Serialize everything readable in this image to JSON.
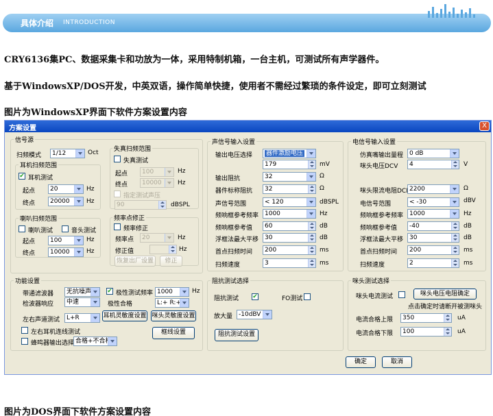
{
  "header": {
    "title": "具体介绍",
    "subtitle": "INTRODUCTION"
  },
  "paragraphs": [
    "CRY6136集PC、数据采集卡和功放为一体，采用特制机箱，一台主机，可测试所有声学器件。",
    "基于WindowsXP/DOS开发，中英双语，操作简单快捷，使用者不需经过繁琐的条件设定，即可立刻测试",
    "图片为WindowsXP界面下软件方案设置内容",
    "图片为DOS界面下软件方案设置内容"
  ],
  "window": {
    "title": "方案设置",
    "close": "X"
  },
  "signal": {
    "legend": "信号源",
    "sweep_mode_label": "扫频模式",
    "sweep_mode": "1/12",
    "oct": "Oct",
    "ear": {
      "legend": "耳机扫频范围",
      "test": "耳机测试",
      "start_label": "起点",
      "start": "20",
      "end_label": "终点",
      "end": "20000",
      "hz": "Hz"
    },
    "horn": {
      "legend": "喇叭扫频范围",
      "speaker": "喇叭测试",
      "sound_head": "音头测试",
      "start_label": "起点",
      "start": "100",
      "end_label": "终点",
      "end": "10000",
      "hz": "Hz"
    },
    "distortion": {
      "legend": "失真扫频范围",
      "test": "失真测试",
      "start_label": "起点",
      "start": "100",
      "end_label": "终点",
      "end": "10000",
      "hz": "Hz",
      "specified": "指定测试声压",
      "spl": "90",
      "dbspl": "dBSPL"
    },
    "freq_fix": {
      "legend": "频率点修正",
      "test": "频率修正",
      "point_label": "频率点",
      "point": "20",
      "hz": "Hz",
      "fix_label": "修正值",
      "restore": "恢复出厂设置",
      "fix_btn": "修正"
    }
  },
  "acoustic": {
    "legend": "声信号输入设置",
    "volt_sel_label": "输出电压选择",
    "volt_sel": "器件激励电压",
    "volt": "179",
    "mv": "mV",
    "out_imp_label": "输出阻抗",
    "out_imp": "32",
    "ohm": "Ω",
    "nom_imp_label": "器件标称阻抗",
    "nom_imp": "32",
    "sig_range_label": "声信号范围",
    "sig_range": "< 120",
    "dbspl": "dBSPL",
    "ref_freq_label": "频响框参考频率",
    "ref_freq": "1000",
    "hz": "Hz",
    "ref_val_label": "频响框参考值",
    "ref_val": "60",
    "db": "dB",
    "float_label": "浮框法最大平移",
    "float": "30",
    "first_time_label": "首点扫频时间",
    "first_time": "200",
    "ms": "ms",
    "speed_label": "扫频速度",
    "speed": "3"
  },
  "electric": {
    "legend": "电信号输入设置",
    "dummy_label": "仿真嘴输出量程",
    "dummy": "0 dB",
    "mic_volt_label": "咪头电压DCV",
    "mic_volt": "4",
    "v": "V",
    "dcr_label": "咪头限流电阻DCR",
    "dcr": "2200",
    "ohm": "Ω",
    "sig_range_label": "电信号范围",
    "sig_range": "< -30",
    "dbv": "dBV",
    "ref_freq_label": "频响框参考频率",
    "ref_freq": "1000",
    "hz": "Hz",
    "ref_val_label": "频响框参考值",
    "ref_val": "-40",
    "db": "dB",
    "float_label": "浮框法最大平移",
    "float": "30",
    "first_time_label": "首点扫频时间",
    "first_time": "200",
    "ms": "ms",
    "speed_label": "扫频速度",
    "speed": "2"
  },
  "function": {
    "legend": "功能设置",
    "filter_label": "带通滤波器",
    "filter": "无抗噪声",
    "polarity": "极性测试频率",
    "polarity_freq": "1000",
    "hz": "Hz",
    "detect_label": "检波器响应",
    "detect": "中速",
    "polarity_ok_label": "极性合格",
    "polarity_ok": "L:+ R:+",
    "lr_label": "左右声道测试",
    "lr": "L+R",
    "ear_sens": "耳机灵敏度设置",
    "mic_sens": "咪头灵敏度设置",
    "lr_ear": "左右耳机连线测试",
    "frame": "框线设置",
    "buzzer_label": "蜂鸣器输出选择",
    "buzzer": "合格+不合格"
  },
  "impedance": {
    "legend": "阻抗测试选择",
    "imp_test": "阻抗测试",
    "fo_test": "FO测试",
    "amp_label": "放大量",
    "amp": "-10dBV",
    "btn": "阻抗测试设置"
  },
  "mic": {
    "legend": "咪头测试选择",
    "current_test": "咪头电流测试",
    "confirm_btn": "咪头电压电阻确定",
    "hint": "点击确定时请断开被测咪头",
    "upper_label": "电流合格上限",
    "upper": "350",
    "lower_label": "电流合格下限",
    "lower": "100",
    "ua": "uA"
  },
  "dialog": {
    "ok": "确定",
    "cancel": "取消"
  }
}
